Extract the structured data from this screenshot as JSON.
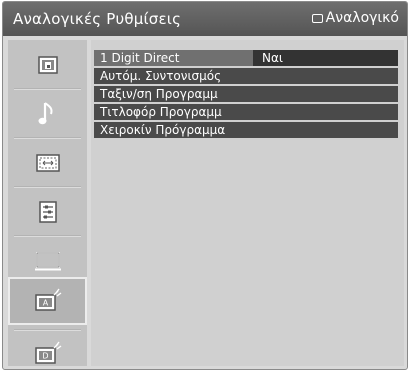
{
  "header": {
    "title": "Αναλογικές Ρυθμίσεις",
    "source_label": "Αναλογικό",
    "source_icon": "tv-icon"
  },
  "sidebar": {
    "items": [
      {
        "icon": "picture-settings-icon",
        "selected": false
      },
      {
        "icon": "sound-note-icon",
        "selected": false
      },
      {
        "icon": "aspect-ratio-icon",
        "selected": false
      },
      {
        "icon": "settings-list-icon",
        "selected": false
      },
      {
        "icon": "monitor-icon",
        "selected": false
      },
      {
        "icon": "analog-tv-settings-icon",
        "selected": true
      },
      {
        "icon": "digital-tv-settings-icon",
        "selected": false
      }
    ]
  },
  "menu": {
    "items": [
      {
        "label": "1 Digit Direct",
        "value": "Ναι",
        "selected": true
      },
      {
        "label": "Αυτόμ. Συντονισμός",
        "value": "",
        "selected": false
      },
      {
        "label": "Ταξιν/ση Προγραμμ",
        "value": "",
        "selected": false
      },
      {
        "label": "Τιτλοφόρ Προγραμμ",
        "value": "",
        "selected": false
      },
      {
        "label": "Χειροκίν Πρόγραμμα",
        "value": "",
        "selected": false
      }
    ]
  },
  "colors": {
    "titlebar": "#5f5f5f",
    "panel": "#d0d0d0",
    "row": "#4a4a4a",
    "row_selected_label": "#707070"
  }
}
